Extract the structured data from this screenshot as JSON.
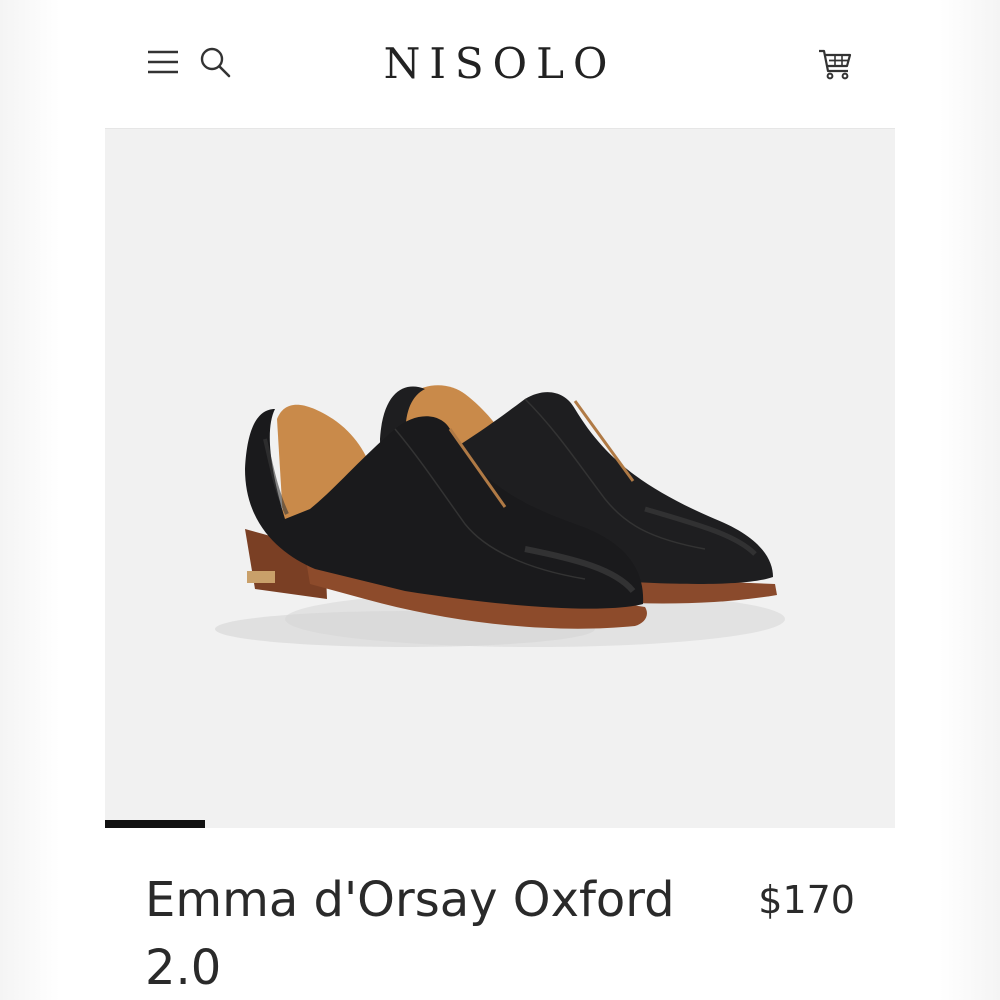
{
  "header": {
    "logo": "NISOLO",
    "menu_icon": "hamburger-menu-icon",
    "search_icon": "search-icon",
    "cart_icon": "shopping-cart-icon"
  },
  "gallery": {
    "image_alt": "Black leather d'Orsay oxford shoes with brown soles",
    "active_slide": 1
  },
  "product": {
    "title": "Emma d'Orsay Oxford 2.0",
    "price": "$170"
  },
  "colors": {
    "text": "#2a2a2a",
    "gallery_bg": "#f1f1f1",
    "indicator": "#111111",
    "shoe_leather": "#1c1c1e",
    "lining": "#c98a4a",
    "sole": "#8a4a2c"
  }
}
